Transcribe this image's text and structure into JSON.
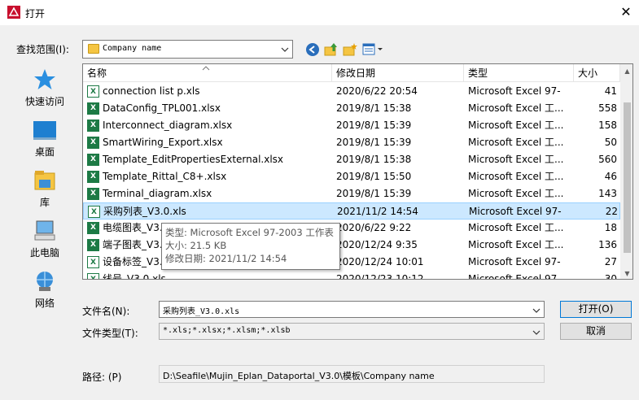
{
  "window": {
    "title": "打开",
    "close_glyph": "✕"
  },
  "lookin": {
    "label": "查找范围(I):",
    "value": "Company name"
  },
  "places": [
    {
      "label": "快速访问",
      "icon": "star-icon"
    },
    {
      "label": "桌面",
      "icon": "desktop-icon"
    },
    {
      "label": "库",
      "icon": "library-icon"
    },
    {
      "label": "此电脑",
      "icon": "computer-icon"
    },
    {
      "label": "网络",
      "icon": "network-icon"
    }
  ],
  "columns": {
    "name": "名称",
    "date": "修改日期",
    "type": "类型",
    "size": "大小"
  },
  "files": [
    {
      "name": "connection  list p.xls",
      "date": "2020/6/22 20:54",
      "type": "Microsoft Excel 97-",
      "size": "41"
    },
    {
      "name": "DataConfig_TPL001.xlsx",
      "date": "2019/8/1 15:38",
      "type": "Microsoft Excel 工...",
      "size": "558"
    },
    {
      "name": "Interconnect_diagram.xlsx",
      "date": "2019/8/1 15:39",
      "type": "Microsoft Excel 工...",
      "size": "158"
    },
    {
      "name": "SmartWiring_Export.xlsx",
      "date": "2019/8/1 15:39",
      "type": "Microsoft Excel 工...",
      "size": "50"
    },
    {
      "name": "Template_EditPropertiesExternal.xlsx",
      "date": "2019/8/1 15:38",
      "type": "Microsoft Excel 工...",
      "size": "560"
    },
    {
      "name": "Template_Rittal_C8+.xlsx",
      "date": "2019/8/1 15:50",
      "type": "Microsoft Excel 工...",
      "size": "46"
    },
    {
      "name": "Terminal_diagram.xlsx",
      "date": "2019/8/1 15:39",
      "type": "Microsoft Excel 工...",
      "size": "143"
    },
    {
      "name": "采购列表_V3.0.xls",
      "date": "2021/11/2 14:54",
      "type": "Microsoft Excel 97-",
      "size": "22"
    },
    {
      "name": "电缆图表_V3.",
      "date": "2020/6/22 9:22",
      "type": "Microsoft Excel 工...",
      "size": "18"
    },
    {
      "name": "端子图表_V3.",
      "date": "2020/12/24 9:35",
      "type": "Microsoft Excel 工...",
      "size": "136"
    },
    {
      "name": "设备标签_V3.",
      "date": "2020/12/24 10:01",
      "type": "Microsoft Excel 97-",
      "size": "27"
    },
    {
      "name": "线号_V3.0.xls",
      "date": "2020/12/23 10:12",
      "type": "Microsoft Excel 97-",
      "size": "30"
    }
  ],
  "selected_index": 7,
  "tooltip": {
    "type": "类型: Microsoft Excel 97-2003 工作表",
    "size": "大小: 21.5 KB",
    "modified": "修改日期: 2021/11/2 14:54"
  },
  "filename": {
    "label": "文件名(N):",
    "value": "采购列表_V3.0.xls"
  },
  "filetype": {
    "label": "文件类型(T):",
    "value": "*.xls;*.xlsx;*.xlsm;*.xlsb"
  },
  "buttons": {
    "open": "打开(O)",
    "cancel": "取消"
  },
  "path": {
    "label": "路径: (P)",
    "value": "D:\\Seafile\\Mujin_Eplan_Dataportal_V3.0\\模板\\Company name"
  },
  "colors": {
    "accent": "#0078d7",
    "selection": "#cce8ff",
    "excel_green": "#1d7a45"
  }
}
